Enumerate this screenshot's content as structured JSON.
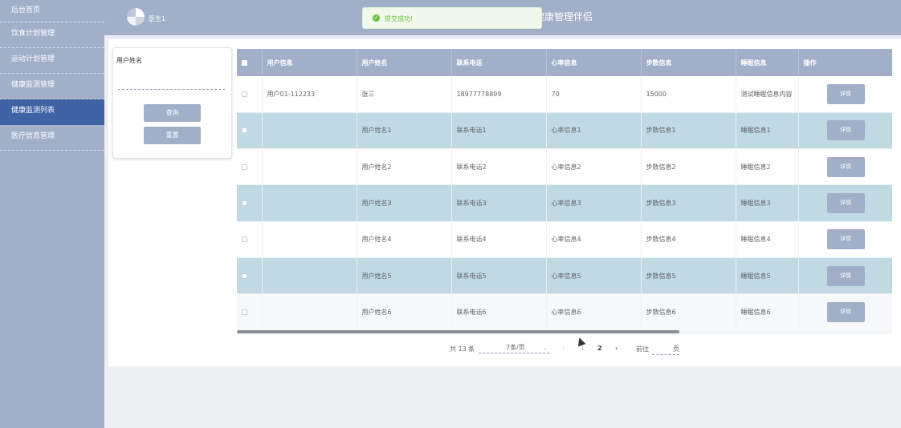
{
  "sidebar": {
    "items": [
      {
        "label": "后台首页"
      },
      {
        "label": "饮食计划管理"
      },
      {
        "label": "运动计划管理"
      },
      {
        "label": "健康监测管理"
      },
      {
        "label": "健康监测列表"
      },
      {
        "label": "医疗信息管理"
      }
    ],
    "active_index": 4
  },
  "header": {
    "user_name": "医生1",
    "title": "健康管理伴侣"
  },
  "toast": {
    "message": "提交成功!",
    "type": "success"
  },
  "search": {
    "label": "用户姓名",
    "value": "",
    "query_label": "查询",
    "reset_label": "重置"
  },
  "table": {
    "columns": [
      "用户信息",
      "用户姓名",
      "联系电话",
      "心率信息",
      "步数信息",
      "睡眠信息",
      "操作"
    ],
    "detail_label": "详情",
    "rows": [
      {
        "user_info": "用户01-112233",
        "name": "张三",
        "phone": "18977778899",
        "heart": "70",
        "steps": "15000",
        "sleep": "测试睡眠信息内容"
      },
      {
        "user_info": "",
        "name": "用户姓名1",
        "phone": "联系电话1",
        "heart": "心率信息1",
        "steps": "步数信息1",
        "sleep": "睡眠信息1"
      },
      {
        "user_info": "",
        "name": "用户姓名2",
        "phone": "联系电话2",
        "heart": "心率信息2",
        "steps": "步数信息2",
        "sleep": "睡眠信息2"
      },
      {
        "user_info": "",
        "name": "用户姓名3",
        "phone": "联系电话3",
        "heart": "心率信息3",
        "steps": "步数信息3",
        "sleep": "睡眠信息3"
      },
      {
        "user_info": "",
        "name": "用户姓名4",
        "phone": "联系电话4",
        "heart": "心率信息4",
        "steps": "步数信息4",
        "sleep": "睡眠信息4"
      },
      {
        "user_info": "",
        "name": "用户姓名5",
        "phone": "联系电话5",
        "heart": "心率信息5",
        "steps": "步数信息5",
        "sleep": "睡眠信息5"
      },
      {
        "user_info": "",
        "name": "用户姓名6",
        "phone": "联系电话6",
        "heart": "心率信息6",
        "steps": "步数信息6",
        "sleep": "睡眠信息6"
      }
    ]
  },
  "pagination": {
    "total": "共 13 条",
    "page_size": "7条/页",
    "pages": [
      "1",
      "2"
    ],
    "current_page": "2",
    "goto_label": "前往",
    "goto_value": "",
    "page_suffix": "页",
    "prev_icon": "chevron-left-icon",
    "next_icon": "chevron-right-icon"
  },
  "colors": {
    "sidebar_bg": "#a2afc9",
    "sidebar_active": "#3f62a4",
    "row_alt": "#c0d9e3",
    "success": "#67c23a"
  }
}
